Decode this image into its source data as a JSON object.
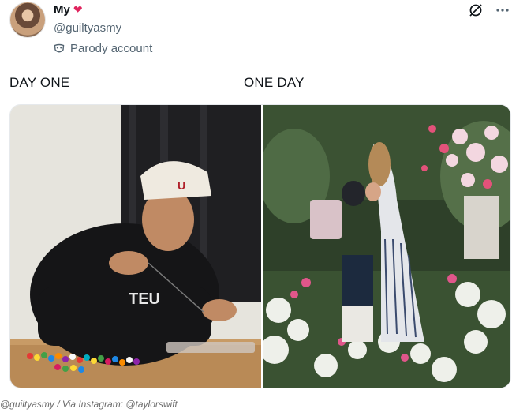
{
  "account": {
    "display_name": "My",
    "name_emoji": "❤",
    "handle": "@guiltyasmy",
    "label": "Parody account"
  },
  "icons": {
    "avatar": "avatar",
    "mask": "parody-mask-icon",
    "slash": "grok-slash-icon",
    "more": "more-icon"
  },
  "post": {
    "caption_left": "DAY ONE",
    "caption_right": "ONE DAY"
  },
  "credit": "@guiltyasmy / Via Instagram: @taylorswift",
  "colors": {
    "text_primary": "#0f1419",
    "text_secondary": "#536471"
  }
}
